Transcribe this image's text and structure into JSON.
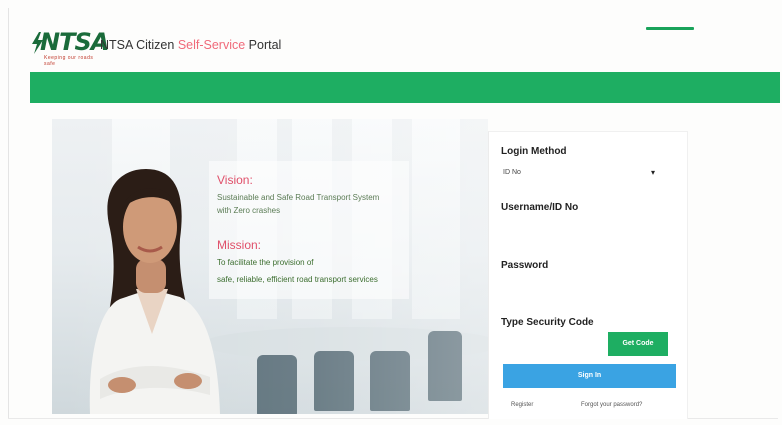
{
  "header": {
    "logo_text": "NTSA",
    "logo_tagline": "Keeping our roads safe",
    "title_prefix": "NTSA Citizen ",
    "title_accent": "Self-Service",
    "title_suffix": " Portal"
  },
  "hero": {
    "vision_heading": "Vision:",
    "vision_line1": "Sustainable and Safe Road Transport System",
    "vision_line2": "with Zero crashes",
    "mission_heading": "Mission:",
    "mission_line1": "To facilitate the provision of",
    "mission_line2": "safe, reliable, efficient road transport services"
  },
  "login": {
    "method_label": "Login Method",
    "method_value": "ID No",
    "username_label": "Username/ID No",
    "password_label": "Password",
    "security_label": "Type Security Code",
    "get_code_label": "Get Code",
    "sign_in_label": "Sign In",
    "register_link": "Register",
    "forgot_link": "Forgot your password?"
  },
  "colors": {
    "brand_green": "#1eae62",
    "sign_in_blue": "#3aa3e3",
    "accent_pink": "#f06a7a"
  }
}
